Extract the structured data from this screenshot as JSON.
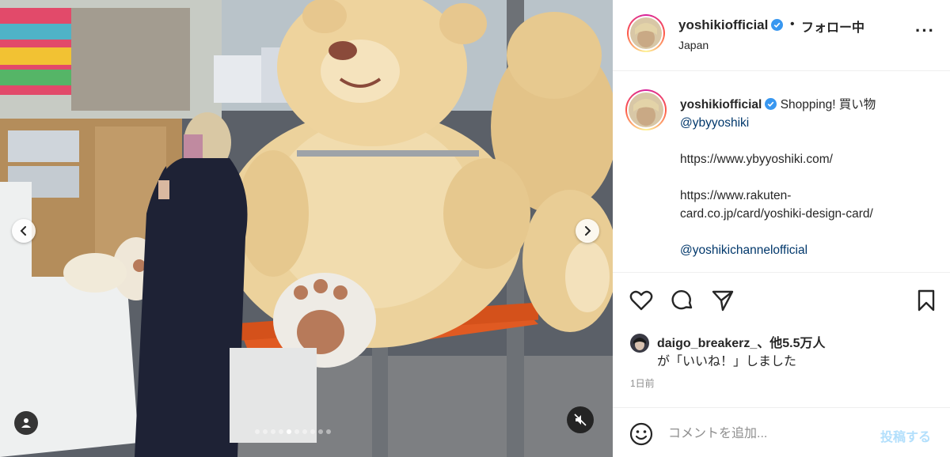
{
  "post": {
    "media": {
      "carousel_dots_total": 10,
      "carousel_active_index": 4
    }
  },
  "header": {
    "username": "yoshikiofficial",
    "separator": "•",
    "follow_status": "フォロー中",
    "location": "Japan",
    "more_icon": "ellipsis-icon"
  },
  "caption": {
    "username": "yoshikiofficial",
    "text": "Shopping! 買い物",
    "mention1": "@ybyyoshiki",
    "link1": "https://www.ybyyoshiki.com/",
    "link2_line1": "https://www.rakuten-",
    "link2_line2": "card.co.jp/card/yoshiki-design-card/",
    "mention2": "@yoshikichannelofficial"
  },
  "actions": {
    "like_icon": "heart-icon",
    "comment_icon": "comment-icon",
    "share_icon": "paper-plane-icon",
    "save_icon": "bookmark-icon"
  },
  "likes": {
    "line1": "daigo_breakerz_、他5.5万人",
    "line2": "が「いいね！」しました"
  },
  "timestamp": "1日前",
  "comment": {
    "placeholder": "コメントを追加...",
    "post_label": "投稿する"
  },
  "colors": {
    "verified": "#3897f0",
    "link": "#00376b",
    "post_disabled": "#b2dffc",
    "muted_text": "#8e8e8e"
  }
}
